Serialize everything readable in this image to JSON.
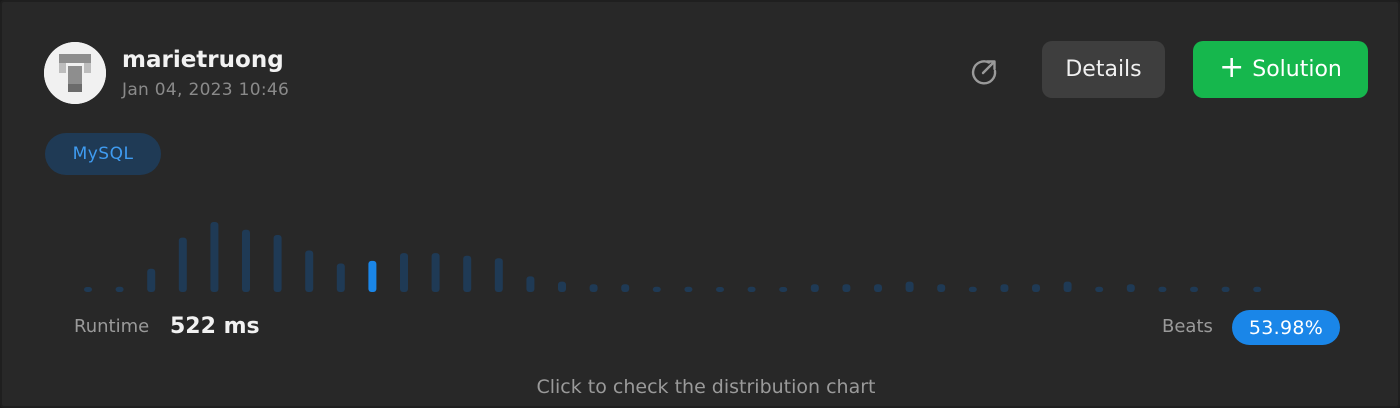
{
  "user": {
    "name": "marietruong",
    "timestamp": "Jan 04, 2023 10:46"
  },
  "actions": {
    "share_icon": "share-icon",
    "details_label": "Details",
    "solution_label": "Solution",
    "solution_icon": "plus-icon"
  },
  "language_tag": "MySQL",
  "runtime": {
    "label": "Runtime",
    "value": "522 ms"
  },
  "beats": {
    "label": "Beats",
    "value": "53.98%"
  },
  "hint": "Click to check the distribution chart",
  "colors": {
    "accent_blue": "#1a86e8",
    "bar_dim": "#1f3a55",
    "bar_highlight": "#1a86e8",
    "solution_green": "#16b74d",
    "card_bg": "#282828"
  },
  "chart_data": {
    "type": "bar",
    "values": [
      1,
      2,
      9,
      21,
      27,
      24,
      22,
      16,
      11,
      12,
      15,
      15,
      14,
      13,
      6,
      4,
      3,
      3,
      2,
      2,
      1,
      2,
      1,
      3,
      3,
      3,
      4,
      3,
      2,
      3,
      3,
      4,
      2,
      3,
      2,
      2,
      2,
      2
    ],
    "highlight_index": 9,
    "title": "",
    "xlabel": "",
    "ylabel": ""
  }
}
